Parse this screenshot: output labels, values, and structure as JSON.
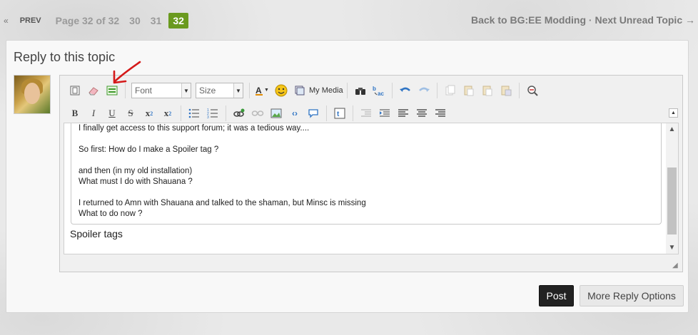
{
  "pagination": {
    "prev_arrow": "«",
    "prev_label": "PREV",
    "page_info": "Page 32 of 32",
    "pages": [
      "30",
      "31"
    ],
    "current_page": "32",
    "current_color": "#6a9a1f"
  },
  "topnav": {
    "back_label": "Back to BG:EE Modding",
    "separator": "·",
    "next_label": "Next Unread Topic →"
  },
  "reply": {
    "heading": "Reply to this topic"
  },
  "toolbar": {
    "font_select": "Font",
    "size_select": "Size",
    "my_media_label": "My Media"
  },
  "editor": {
    "quote_lines": [
      "I finally get access to this support forum; it was a tedious way....",
      "",
      "So first: How do I make a Spoiler tag ?",
      "",
      "and then (in my old installation)",
      "What must I do with Shauana ?",
      "",
      "I returned to Amn with Shauana and talked to the shaman, but Minsc is missing",
      "What to do now ?"
    ],
    "typed_text": "Spoiler tags"
  },
  "buttons": {
    "post": "Post",
    "more_options": "More Reply Options"
  },
  "icons": [
    "source-icon",
    "eraser-icon",
    "spoiler-icon",
    "font-color-icon",
    "smiley-icon",
    "media-icon",
    "find-icon",
    "replace-icon",
    "undo-icon",
    "redo-icon",
    "cut-icon",
    "copy-icon",
    "paste-icon",
    "paste-word-icon",
    "preview-icon",
    "bold-icon",
    "italic-icon",
    "underline-icon",
    "strikethrough-icon",
    "subscript-icon",
    "superscript-icon",
    "bullet-list-icon",
    "number-list-icon",
    "link-icon",
    "unlink-icon",
    "image-icon",
    "code-icon",
    "quote-icon",
    "twitter-icon",
    "outdent-icon",
    "indent-icon",
    "align-left-icon",
    "align-center-icon",
    "align-right-icon"
  ]
}
